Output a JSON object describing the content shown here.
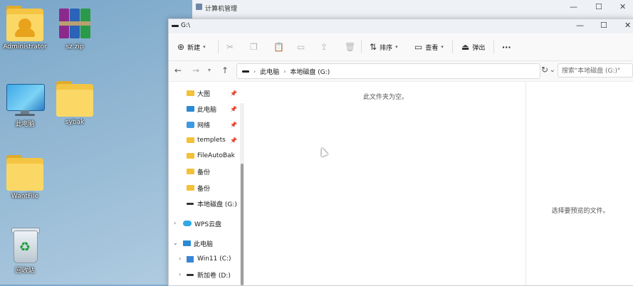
{
  "desktop": {
    "icons": [
      {
        "label": "Administrator"
      },
      {
        "label": "sz.zip"
      },
      {
        "label": "此电脑"
      },
      {
        "label": "sybak"
      },
      {
        "label": "WantFile"
      },
      {
        "label": "回收站"
      }
    ]
  },
  "bg_window": {
    "title": "计算机管理",
    "min": "—",
    "max": "☐",
    "close": "✕"
  },
  "explorer": {
    "title": "G:\\",
    "controls": {
      "min": "—",
      "max": "☐",
      "close": "✕"
    },
    "toolbar": {
      "new_label": "新建",
      "sort_label": "排序",
      "view_label": "查看",
      "eject_label": "弹出",
      "more_label": "···"
    },
    "address": {
      "crumbs": [
        "此电脑",
        "本地磁盘 (G:)"
      ],
      "separator": "›"
    },
    "search": {
      "placeholder": "搜索\"本地磁盘 (G:)\""
    },
    "nav": {
      "items": [
        {
          "label": "大图",
          "pinned": true
        },
        {
          "label": "此电脑",
          "pinned": true
        },
        {
          "label": "网络",
          "pinned": true
        },
        {
          "label": "templets",
          "pinned": true
        },
        {
          "label": "FileAutoBak"
        },
        {
          "label": "备份"
        },
        {
          "label": "备份"
        },
        {
          "label": "本地磁盘 (G:)"
        },
        {
          "label": "WPS云盘"
        },
        {
          "label": "此电脑"
        },
        {
          "label": "Win11 (C:)"
        },
        {
          "label": "新加卷 (D:)"
        }
      ]
    },
    "content": {
      "empty_text": "此文件夹为空。"
    },
    "preview": {
      "text": "选择要预览的文件。"
    }
  }
}
